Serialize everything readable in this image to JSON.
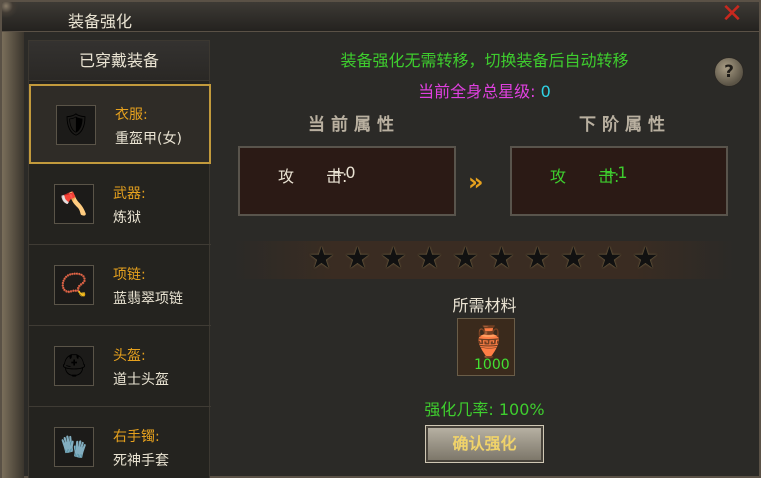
{
  "window": {
    "title": "装备强化",
    "close_icon": "close-x-icon"
  },
  "sidebar": {
    "header": "已穿戴装备",
    "items": [
      {
        "type": "衣服:",
        "name": "重盔甲(女)",
        "icon": "armor-icon",
        "glyph": "🛡",
        "selected": true
      },
      {
        "type": "武器:",
        "name": "炼狱",
        "icon": "axe-icon",
        "glyph": "🪓"
      },
      {
        "type": "项链:",
        "name": "蓝翡翠项链",
        "icon": "necklace-icon",
        "glyph": "📿"
      },
      {
        "type": "头盔:",
        "name": "道士头盔",
        "icon": "helmet-icon",
        "glyph": "⛑"
      },
      {
        "type": "右手镯:",
        "name": "死神手套",
        "icon": "glove-icon",
        "glyph": "🧤"
      }
    ]
  },
  "main": {
    "notice": "装备强化无需转移，切换装备后自动转移",
    "star_total_label": "当前全身总星级:",
    "star_total_value": "0",
    "help_glyph": "?",
    "current_header": "当前属性",
    "next_header": "下阶属性",
    "current_attr": {
      "key": "攻　　击:",
      "value": "+0"
    },
    "next_attr": {
      "key": "攻　　击:",
      "value": "+1"
    },
    "arrow_glyph": "»",
    "stars_filled": 0,
    "stars_total": 10,
    "material_label": "所需材料",
    "material": {
      "icon": "gold-ingot-icon",
      "glyph": "🏺",
      "count": "1000"
    },
    "rate": "强化几率: 100%",
    "confirm_label": "确认强化"
  },
  "colors": {
    "green": "#3ecd2e",
    "gold": "#e6a11e",
    "magenta": "#e040e0",
    "cyan": "#2fd3e6"
  }
}
